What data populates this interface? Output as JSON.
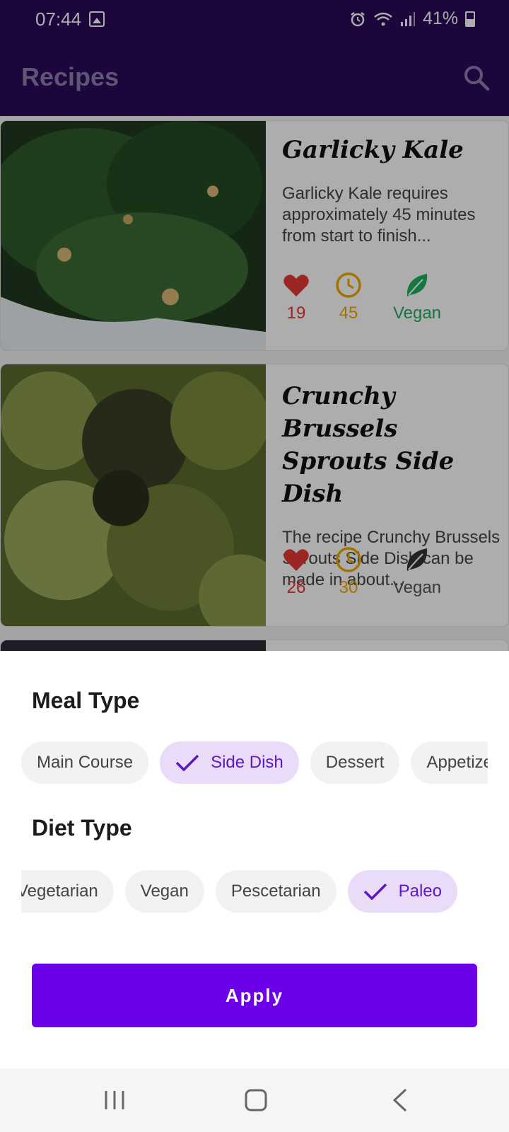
{
  "status": {
    "time": "07:44",
    "battery": "41%"
  },
  "app": {
    "title": "Recipes"
  },
  "recipes": [
    {
      "title": "Garlicky Kale",
      "description": "Garlicky Kale requires approximately 45 minutes from start to finish...",
      "likes": "19",
      "minutes": "45",
      "diet": "Vegan",
      "vegan_active": true
    },
    {
      "title": "Crunchy Brussels Sprouts Side Dish",
      "description": "The recipe Crunchy Brussels Sprouts Side Dish can be made in about...",
      "likes": "26",
      "minutes": "30",
      "diet": "Vegan",
      "vegan_active": false
    }
  ],
  "filters": {
    "meal_type_title": "Meal Type",
    "meal_types": [
      "Main Course",
      "Side Dish",
      "Dessert",
      "Appetizer"
    ],
    "meal_type_selected": "Side Dish",
    "diet_type_title": "Diet Type",
    "diet_types": [
      "Vegetarian",
      "Vegan",
      "Pescetarian",
      "Paleo"
    ],
    "diet_type_selected": "Paleo",
    "apply_label": "Apply"
  },
  "colors": {
    "app_bar": "#2a0a57",
    "accent": "#6c00e8",
    "chip_selected_bg": "#eadcf8",
    "likes": "#e53935",
    "time": "#f2a900",
    "vegan": "#1fae5f"
  }
}
